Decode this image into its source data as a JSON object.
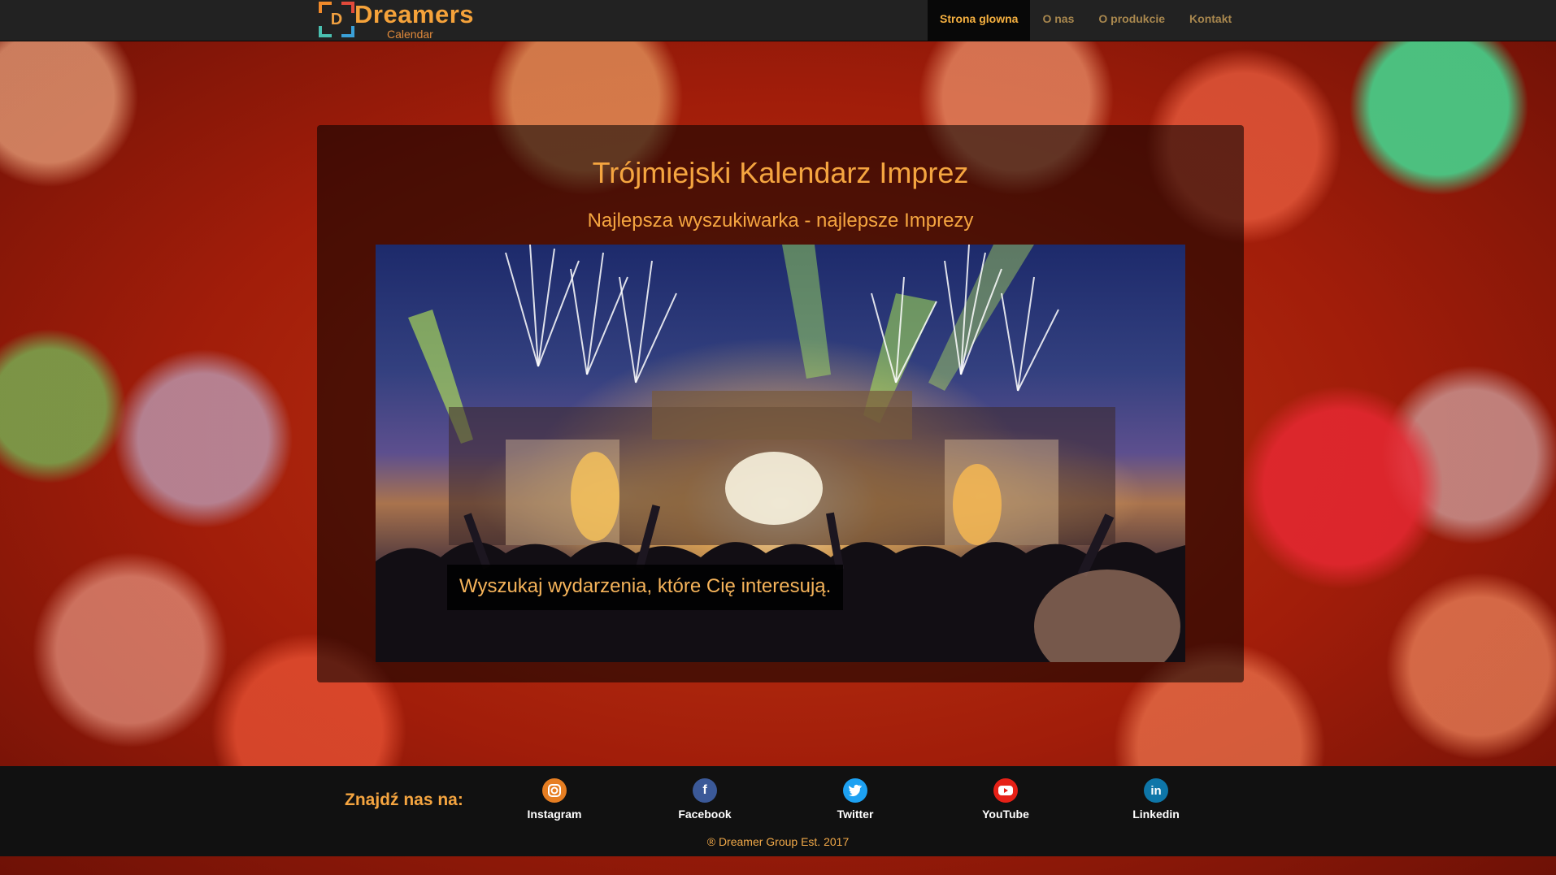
{
  "brand": {
    "name": "Dreamers",
    "subtitle": "Calendar",
    "logo_letter": "D"
  },
  "nav": {
    "items": [
      {
        "label": "Strona glowna",
        "active": true
      },
      {
        "label": "O nas",
        "active": false
      },
      {
        "label": "O produkcie",
        "active": false
      },
      {
        "label": "Kontakt",
        "active": false
      }
    ]
  },
  "main": {
    "title": "Trójmiejski Kalendarz Imprez",
    "subtitle": "Najlepsza wyszukiwarka - najlepsze Imprezy",
    "hero_caption": "Wyszukaj wydarzenia, które Cię interesują."
  },
  "footer": {
    "find_us": "Znajdź nas na:",
    "socials": [
      {
        "label": "Instagram",
        "icon": "instagram-icon",
        "color": "#e67e22"
      },
      {
        "label": "Facebook",
        "icon": "facebook-icon",
        "color": "#3b5998"
      },
      {
        "label": "Twitter",
        "icon": "twitter-icon",
        "color": "#1da1f2"
      },
      {
        "label": "YouTube",
        "icon": "youtube-icon",
        "color": "#e62117"
      },
      {
        "label": "Linkedin",
        "icon": "linkedin-icon",
        "color": "#0e76a8"
      }
    ],
    "copyright": "® Dreamer Group Est. 2017"
  },
  "colors": {
    "accent": "#f5a540",
    "navbar": "#222222",
    "footer": "#111111"
  }
}
